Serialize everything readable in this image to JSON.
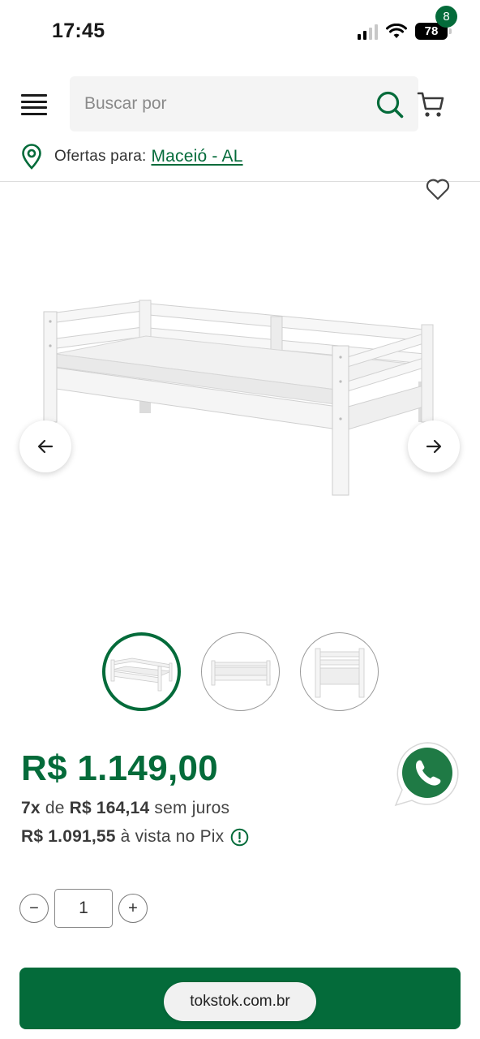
{
  "status_bar": {
    "time": "17:45",
    "battery": "78",
    "icons": [
      "cellular-signal-icon",
      "wifi-icon",
      "battery-icon"
    ]
  },
  "header": {
    "search_placeholder": "Buscar por",
    "cart_count": "8",
    "icons": [
      "menu-icon",
      "search-icon",
      "cart-icon"
    ]
  },
  "location": {
    "label": "Ofertas para:",
    "city": "Maceió - AL",
    "icon": "location-pin-icon"
  },
  "gallery": {
    "thumbnails": [
      "thumbnail-1",
      "thumbnail-2",
      "thumbnail-3"
    ],
    "active_thumbnail": 1,
    "icons": [
      "heart-icon",
      "arrow-left-icon",
      "arrow-right-icon"
    ]
  },
  "price": {
    "main": "R$ 1.149,00",
    "installments_count": "7x",
    "installments_of": "de",
    "installment_value": "R$ 164,14",
    "installments_suffix": "sem juros",
    "pix_value": "R$ 1.091,55",
    "pix_suffix": "à vista no Pix"
  },
  "quantity": {
    "value": "1",
    "minus": "−",
    "plus": "+"
  },
  "browser": {
    "url": "tokstok.com.br"
  },
  "colors": {
    "brand_green": "#046b3a",
    "search_bg": "#f4f4f4",
    "whatsapp_green": "#1f7a45"
  }
}
